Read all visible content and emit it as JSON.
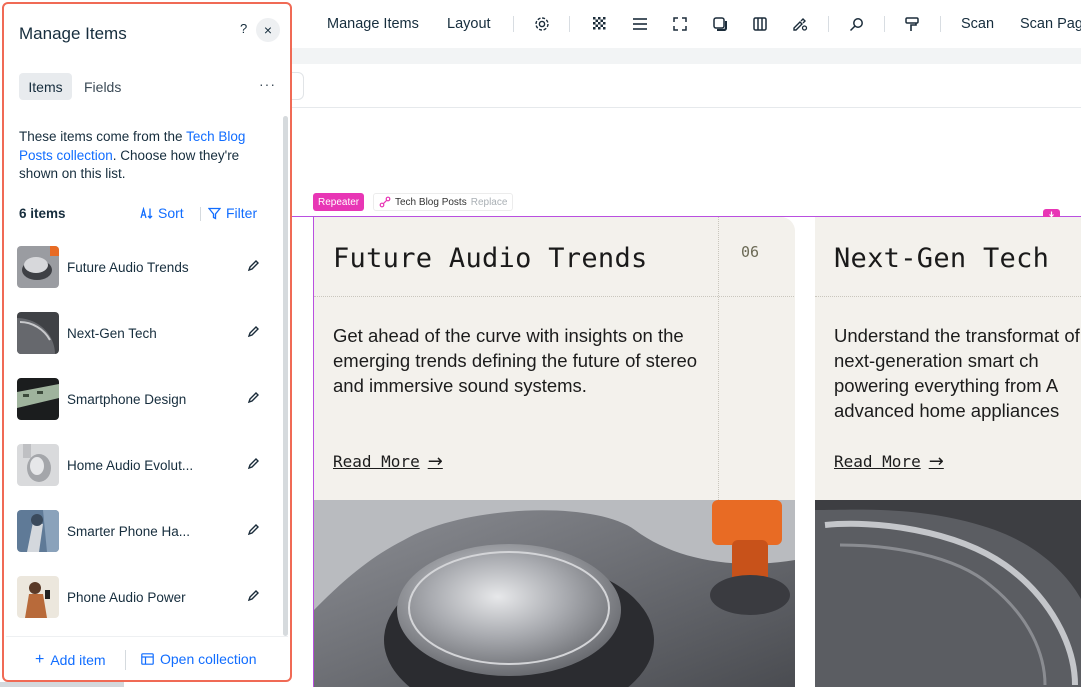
{
  "toolbar": {
    "manage_items": "Manage Items",
    "layout": "Layout",
    "scan": "Scan",
    "scan_page": "Scan Pag",
    "icons": [
      "gear-icon",
      "pattern-icon",
      "align-icon",
      "crop-icon",
      "shadow-icon",
      "columns-icon",
      "pen-settings-icon",
      "search-icon",
      "paint-icon"
    ]
  },
  "canvas": {
    "repeater_badge": "Repeater",
    "dataset_name": "Tech Blog Posts",
    "dataset_replace": "Replace",
    "cards": [
      {
        "title": "Future Audio Trends",
        "number": "06",
        "body": "Get ahead of the curve with insights on the emerging trends defining the future of stereo and immersive sound systems.",
        "link": "Read More"
      },
      {
        "title": "Next-Gen Tech",
        "body": "Understand the transformat of next-generation smart ch powering everything from A advanced home appliances",
        "link": "Read More"
      }
    ]
  },
  "panel": {
    "title": "Manage Items",
    "help": "?",
    "close": "×",
    "tabs": {
      "items": "Items",
      "fields": "Fields"
    },
    "more": "···",
    "description_pre": "These items come from the ",
    "description_link": "Tech Blog Posts collection",
    "description_post": ". Choose how they're shown on this list.",
    "count": "6 items",
    "sort": "Sort",
    "filter": "Filter",
    "items": [
      {
        "label": "Future Audio Trends"
      },
      {
        "label": "Next-Gen Tech"
      },
      {
        "label": "Smartphone Design"
      },
      {
        "label": "Home Audio Evolut..."
      },
      {
        "label": "Smarter Phone Ha..."
      },
      {
        "label": "Phone Audio Power"
      }
    ],
    "add_item": "Add item",
    "open_collection": "Open collection"
  },
  "colors": {
    "accent": "#116dff",
    "panel_border": "#f06a55",
    "repeater": "#e836b5",
    "selection": "#b94fe0",
    "card_bg": "#f3f1ec"
  }
}
